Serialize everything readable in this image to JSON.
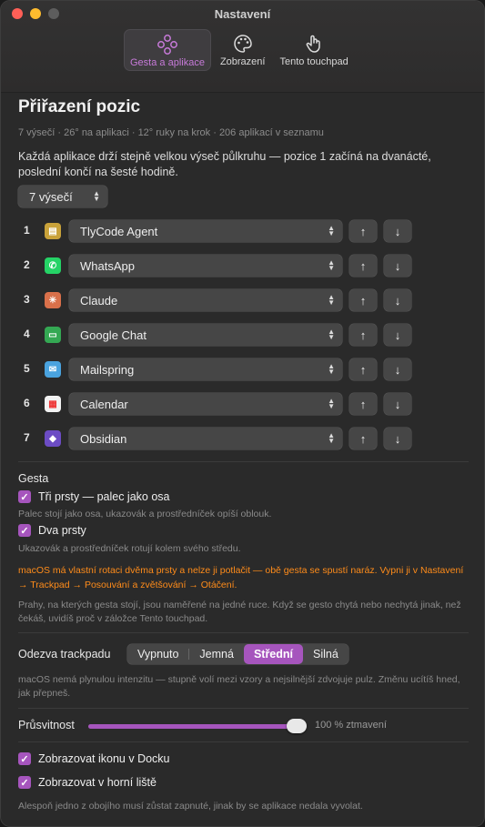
{
  "window": {
    "title": "Nastavení"
  },
  "tabs": [
    {
      "label": "Gesta a aplikace",
      "icon": "gestures-icon",
      "active": true
    },
    {
      "label": "Zobrazení",
      "icon": "palette-icon",
      "active": false
    },
    {
      "label": "Tento touchpad",
      "icon": "hand-pointer-icon",
      "active": false
    }
  ],
  "positions": {
    "heading": "Přiřazení pozic",
    "subtitle": "7 výsečí · 26° na aplikaci · 12° ruky na krok · 206 aplikací v seznamu",
    "description": "Každá aplikace drží stejně velkou výseč půlkruhu — pozice 1 začíná na dvanácté, poslední končí na šesté hodině.",
    "slice_count": "7 výsečí",
    "rows": [
      {
        "num": "1",
        "app": "TlyCode Agent",
        "icon_color": "#c9a23a",
        "icon_glyph": "▤"
      },
      {
        "num": "2",
        "app": "WhatsApp",
        "icon_color": "#25d366",
        "icon_glyph": "✆"
      },
      {
        "num": "3",
        "app": "Claude",
        "icon_color": "#d9704a",
        "icon_glyph": "✳"
      },
      {
        "num": "4",
        "app": "Google Chat",
        "icon_color": "#34a853",
        "icon_glyph": "▭"
      },
      {
        "num": "5",
        "app": "Mailspring",
        "icon_color": "#4aa3df",
        "icon_glyph": "✉"
      },
      {
        "num": "6",
        "app": "Calendar",
        "icon_color": "#f2f2f2",
        "icon_glyph": "▦"
      },
      {
        "num": "7",
        "app": "Obsidian",
        "icon_color": "#6c4cc4",
        "icon_glyph": "◆"
      }
    ],
    "up_glyph": "↑",
    "down_glyph": "↓"
  },
  "gestures": {
    "heading": "Gesta",
    "three_fingers_label": "Tři prsty — palec jako osa",
    "three_fingers_note": "Palec stojí jako osa, ukazovák a prostředníček opíší oblouk.",
    "two_fingers_label": "Dva prsty",
    "two_fingers_note": "Ukazovák a prostředníček rotují kolem svého středu.",
    "warning": "macOS má vlastní rotaci dvěma prsty a nelze ji potlačit — obě gesta se spustí naráz. Vypni ji v Nastavení → Trackpad → Posouvání a zvětšování → Otáčení.",
    "thresholds_note": "Prahy, na kterých gesta stojí, jsou naměřené na jedné ruce. Když se gesto chytá nebo nechytá jinak, než čekáš, uvidíš proč v záložce Tento touchpad."
  },
  "haptics": {
    "label": "Odezva trackpadu",
    "options": [
      "Vypnuto",
      "Jemná",
      "Střední",
      "Silná"
    ],
    "selected": "Střední",
    "note": "macOS nemá plynulou intenzitu — stupně volí mezi vzory a nejsilnější zdvojuje pulz. Změnu ucítíš hned, jak přepneš."
  },
  "transparency": {
    "label": "Průsvitnost",
    "value_percent": 100,
    "value_label": "100 % ztmavení"
  },
  "visibility": {
    "dock_label": "Zobrazovat ikonu v Docku",
    "menubar_label": "Zobrazovat v horní liště",
    "note": "Alespoň jedno z obojího musí zůstat zapnuté, jinak by se aplikace nedala vyvolat."
  },
  "colors": {
    "accent": "#a655bd",
    "warning": "#ff8c1a"
  }
}
